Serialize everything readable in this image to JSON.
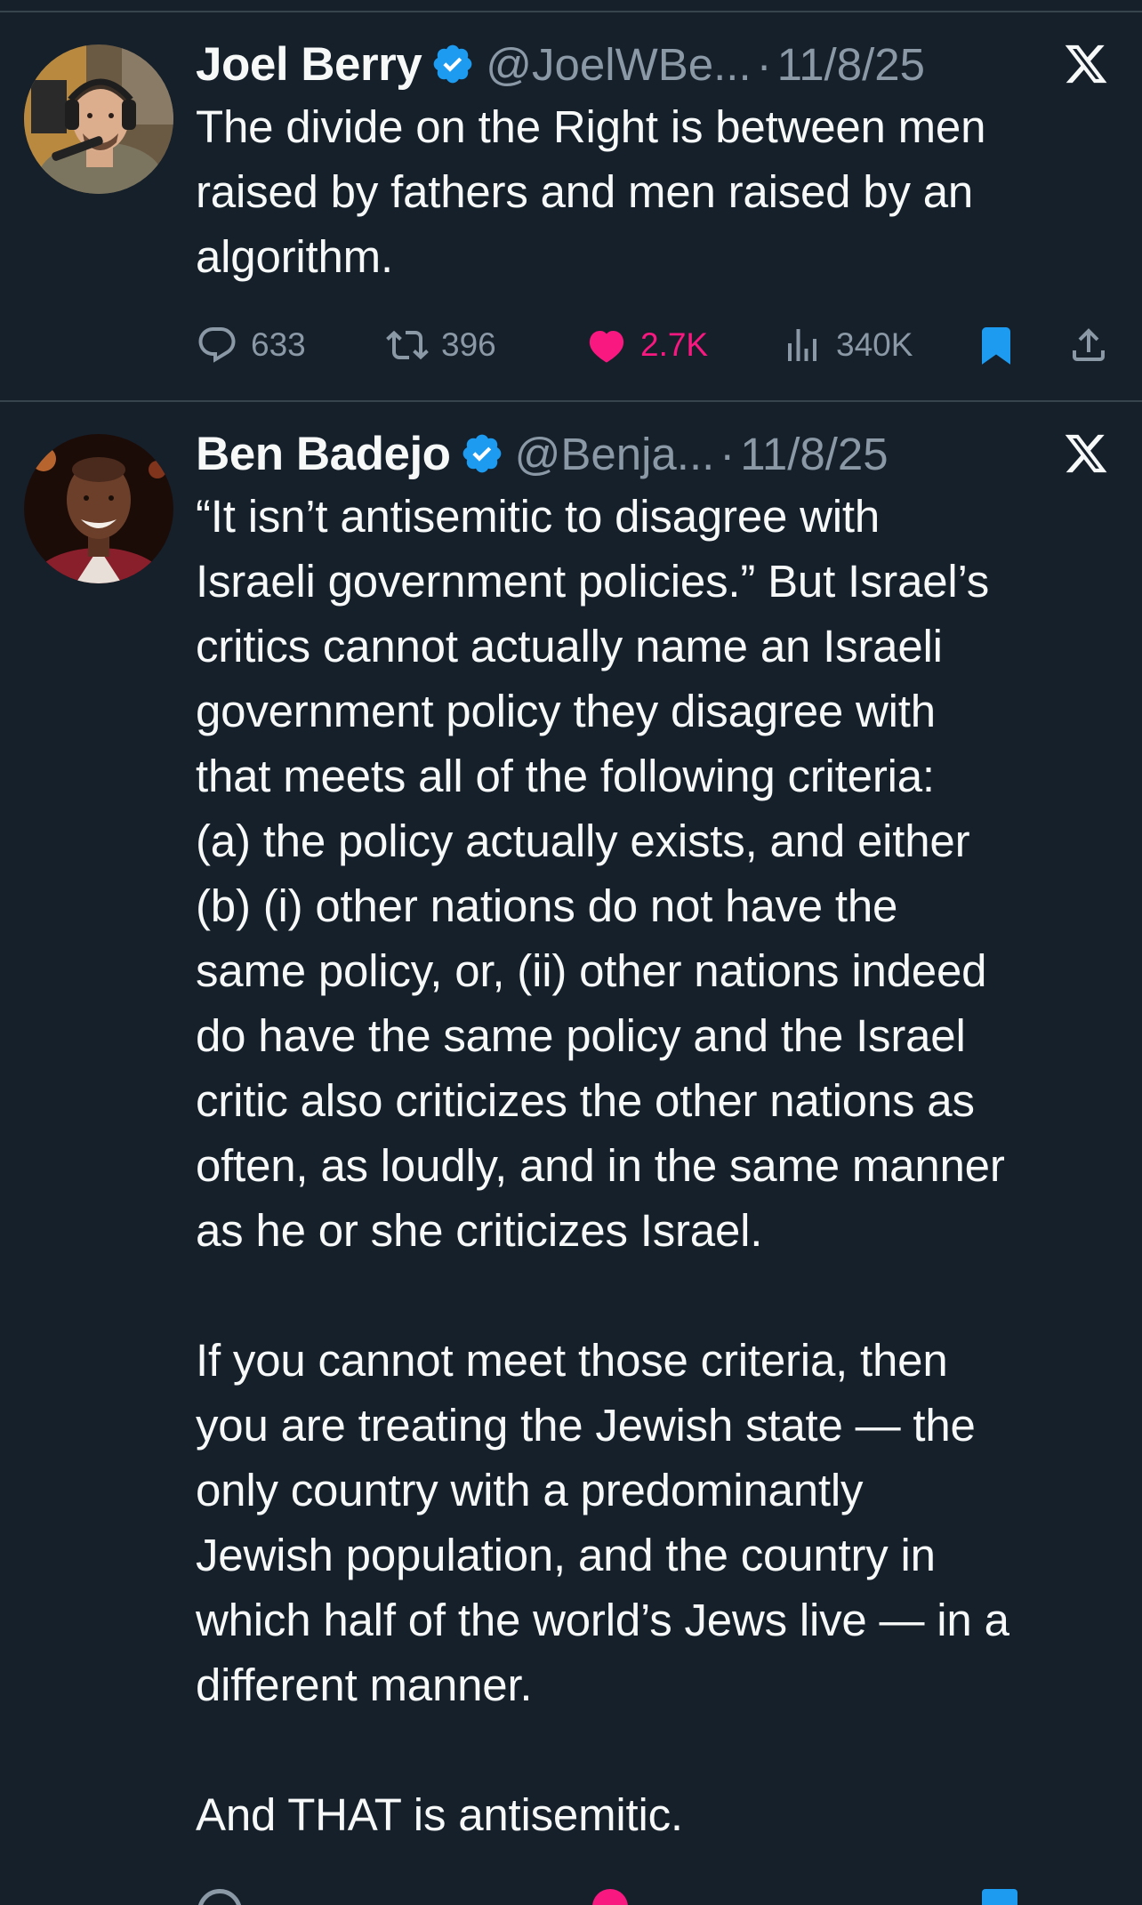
{
  "tweets": [
    {
      "author": "Joel Berry",
      "handle": "@JoelWBe...",
      "separator": "·",
      "date": "11/8/25",
      "text": "The divide on the Right is between men\nraised by fathers and men raised by an\nalgorithm.",
      "stats": {
        "replies": "633",
        "retweets": "396",
        "likes": "2.7K",
        "views": "340K"
      },
      "liked": true,
      "bookmarked": true
    },
    {
      "author": "Ben Badejo",
      "handle": "@Benja...",
      "separator": "·",
      "date": "11/8/25",
      "text": "“It isn’t antisemitic to disagree with\nIsraeli government policies.” But Israel’s\ncritics cannot actually name an Israeli\ngovernment policy they disagree with\nthat meets all of the following criteria:\n(a) the policy actually exists, and either\n(b) (i) other nations do not have the\nsame policy, or, (ii) other nations indeed\ndo have the same policy and the Israel\ncritic also criticizes the other nations as\noften, as loudly, and in the same manner\nas he or she criticizes Israel.\n\nIf you cannot meet those criteria, then\nyou are treating the Jewish state — the\nonly country with a predominantly\nJewish population, and the country in\nwhich half of the world’s Jews live — in a\ndifferent manner.\n\nAnd THAT is antisemitic."
    }
  ],
  "colors": {
    "background": "#15202b",
    "text": "#f7f9f9",
    "muted": "#8b98a5",
    "verified": "#1d9bf0",
    "like": "#f91880",
    "divider": "#38444d"
  },
  "icons": {
    "verified": "verified-badge-icon",
    "source": "x-logo-icon",
    "reply": "reply-icon",
    "retweet": "retweet-icon",
    "like": "heart-icon",
    "views": "views-icon",
    "bookmark": "bookmark-icon",
    "share": "share-icon"
  }
}
